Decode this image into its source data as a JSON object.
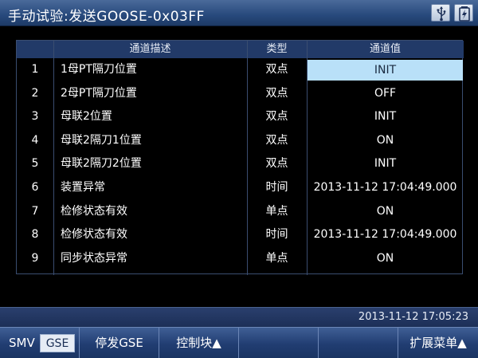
{
  "window": {
    "title": "手动试验:发送GOOSE-0x03FF"
  },
  "icons": {
    "usb": "usb-icon",
    "battery": "battery-icon"
  },
  "table": {
    "headers": {
      "index": "",
      "desc": "通道描述",
      "type": "类型",
      "value": "通道值"
    },
    "rows": [
      {
        "index": "1",
        "desc": "1母PT隔刀位置",
        "type": "双点",
        "value": "INIT",
        "selected": true
      },
      {
        "index": "2",
        "desc": "2母PT隔刀位置",
        "type": "双点",
        "value": "OFF"
      },
      {
        "index": "3",
        "desc": "母联2位置",
        "type": "双点",
        "value": "INIT"
      },
      {
        "index": "4",
        "desc": "母联2隔刀1位置",
        "type": "双点",
        "value": "ON"
      },
      {
        "index": "5",
        "desc": "母联2隔刀2位置",
        "type": "双点",
        "value": "INIT"
      },
      {
        "index": "6",
        "desc": "装置异常",
        "type": "时间",
        "value": "2013-11-12 17:04:49.000"
      },
      {
        "index": "7",
        "desc": "检修状态有效",
        "type": "单点",
        "value": "ON"
      },
      {
        "index": "8",
        "desc": "检修状态有效",
        "type": "时间",
        "value": "2013-11-12 17:04:49.000"
      },
      {
        "index": "9",
        "desc": "同步状态异常",
        "type": "单点",
        "value": "ON"
      }
    ]
  },
  "status": {
    "datetime": "2013-11-12 17:05:23"
  },
  "menu": {
    "smv": "SMV",
    "gse": "GSE",
    "resend": "停发GSE",
    "control_block": "控制块▲",
    "empty1": "",
    "empty2": "",
    "extend": "扩展菜单▲"
  },
  "colors": {
    "title_bg": "#27497c",
    "header_bg": "#223a68",
    "selected_bg": "#b9e0f8",
    "menu_bg": "#213d72"
  }
}
